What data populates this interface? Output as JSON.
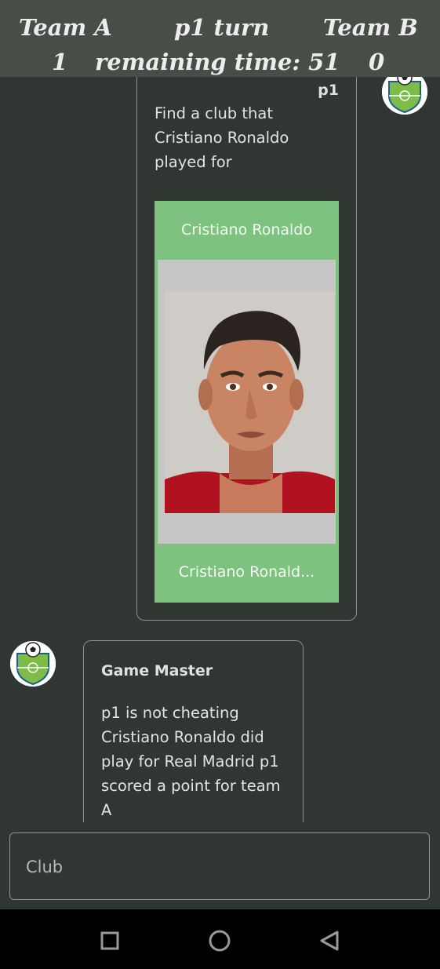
{
  "header": {
    "team_a_label": "Team A",
    "turn_label": "p1 turn",
    "team_b_label": "Team B",
    "team_a_score": "1",
    "remaining_time": "remaining time: 51",
    "team_b_score": "0"
  },
  "messages": [
    {
      "sender": "p1",
      "text": "Find a club that Cristiano Ronaldo played for",
      "card": {
        "title": "Cristiano Ronaldo",
        "footer": "Cristiano Ronald..."
      }
    },
    {
      "sender": "Game Master",
      "text": "p1 is not cheating Cristiano Ronaldo did play for Real Madrid p1 scored a point for team A"
    }
  ],
  "input": {
    "placeholder": "Club",
    "value": ""
  },
  "icons": {
    "avatar": "soccer-badge-icon",
    "nav_recent": "square-icon",
    "nav_home": "circle-icon",
    "nav_back": "triangle-back-icon"
  },
  "colors": {
    "background": "#303631",
    "header": "#474e47",
    "card_green": "#7dc27e",
    "nav_bar": "#000000"
  }
}
